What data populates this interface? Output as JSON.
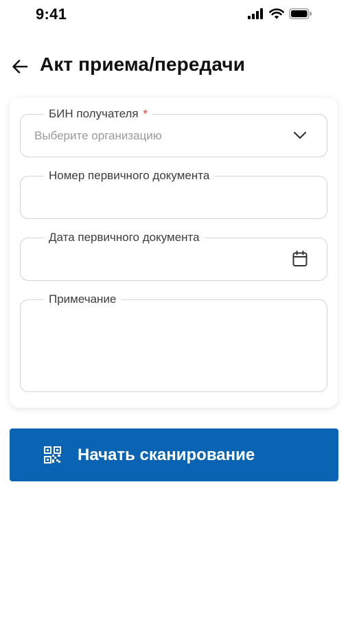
{
  "status_bar": {
    "time": "9:41",
    "icons": [
      "cellular-signal-icon",
      "wifi-icon",
      "battery-icon"
    ]
  },
  "header": {
    "back_icon": "arrow-left-icon",
    "title": "Акт приема/передачи"
  },
  "form": {
    "recipient_bin": {
      "label": "БИН получателя",
      "required_mark": "*",
      "placeholder": "Выберите организацию",
      "value": "",
      "icon": "chevron-down-icon"
    },
    "primary_doc_number": {
      "label": "Номер первичного документа",
      "value": ""
    },
    "primary_doc_date": {
      "label": "Дата первичного документа",
      "value": "",
      "icon": "calendar-icon"
    },
    "note": {
      "label": "Примечание",
      "value": ""
    }
  },
  "actions": {
    "start_scan_label": "Начать сканирование",
    "start_scan_icon": "qr-code-icon"
  },
  "colors": {
    "primary": "#0b63b3",
    "required": "#e53935",
    "field_border": "#cfd3da",
    "placeholder": "#9a9a9a"
  }
}
